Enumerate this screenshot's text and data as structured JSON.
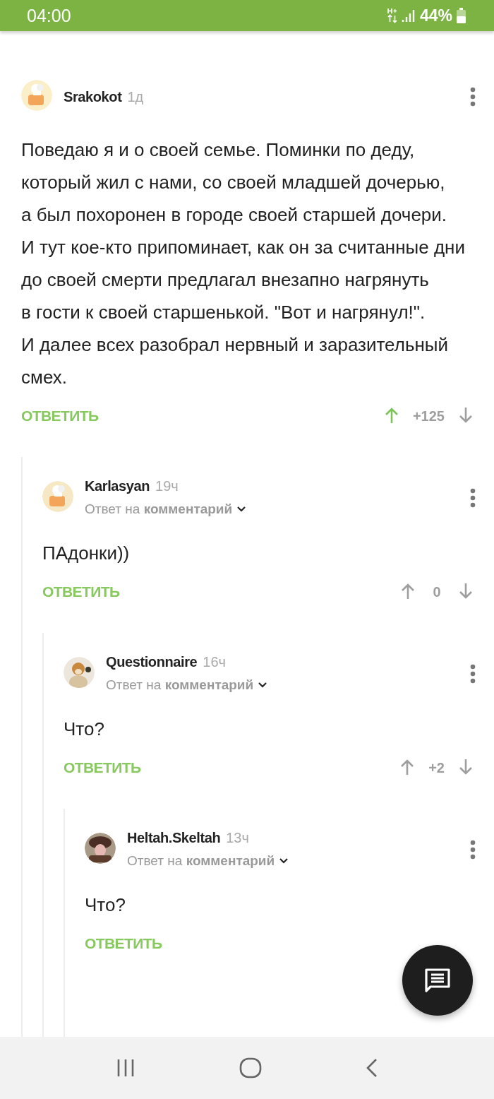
{
  "status_bar": {
    "time": "04:00",
    "battery": "44%"
  },
  "comments": [
    {
      "author": "Srakokot",
      "time": "1д",
      "body": "Поведаю я и о своей семье. Поминки по деду, который жил с нами, со своей младшей дочерью, а был похоронен в городе своей старшей дочери.\nИ тут кое-кто припоминает, как он за считанные дни до своей смерти предлагал внезапно нагрянуть в гости к своей старшенькой. \"Вот и нагрянул!\".\nИ далее всех разобрал нервный и заразительный смех.",
      "reply_label": "ОТВЕТИТЬ",
      "votes": {
        "upvoted": true,
        "score": "+125"
      },
      "children": [
        {
          "author": "Karlasyan",
          "time": "19ч",
          "reply_to": {
            "prefix": "Ответ на",
            "link": "комментарий"
          },
          "body": "ПАдонки))",
          "reply_label": "ОТВЕТИТЬ",
          "votes": {
            "upvoted": false,
            "score": "0"
          },
          "children": [
            {
              "author": "Questionnaire",
              "time": "16ч",
              "reply_to": {
                "prefix": "Ответ на",
                "link": "комментарий"
              },
              "body": "Что?",
              "reply_label": "ОТВЕТИТЬ",
              "votes": {
                "upvoted": false,
                "score": "+2"
              },
              "children": [
                {
                  "author": "Heltah.Skeltah",
                  "time": "13ч",
                  "reply_to": {
                    "prefix": "Ответ на",
                    "link": "комментарий"
                  },
                  "body": "Что?",
                  "reply_label": "ОТВЕТИТЬ"
                }
              ]
            }
          ]
        }
      ]
    }
  ]
}
